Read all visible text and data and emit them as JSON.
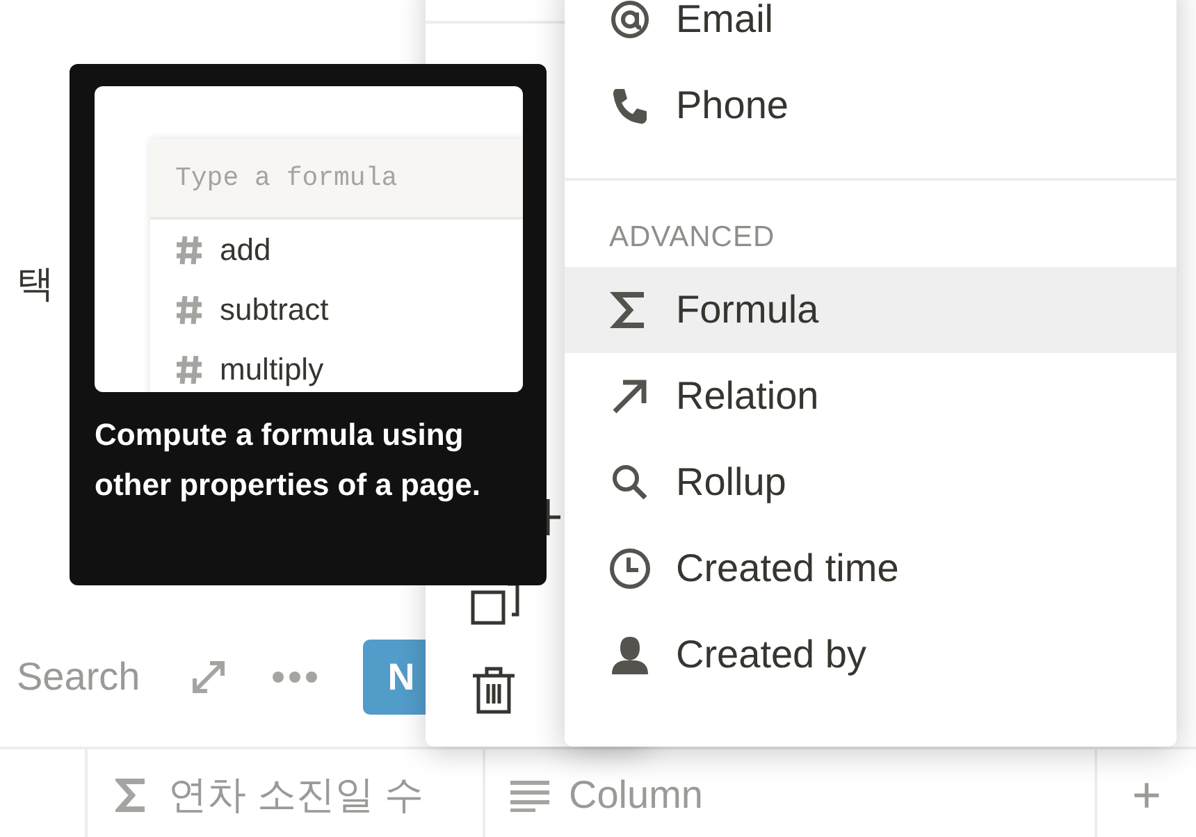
{
  "page": {
    "heading_fragment": "택",
    "toolbar": {
      "search_label": "Search",
      "new_button": "N"
    },
    "table_header": [
      {
        "kind": "formula",
        "label": "연차 소진일 수"
      },
      {
        "kind": "text",
        "label": "Column"
      },
      {
        "kind": "add",
        "label": "+"
      }
    ]
  },
  "back_menu": {
    "items": [
      {
        "kind": "insert"
      },
      {
        "kind": "duplicate"
      },
      {
        "kind": "delete"
      }
    ]
  },
  "type_menu": {
    "sections": [
      {
        "items": [
          {
            "kind": "email",
            "label": "Email",
            "highlighted": false
          },
          {
            "kind": "phone",
            "label": "Phone",
            "highlighted": false
          }
        ]
      },
      {
        "header": "ADVANCED",
        "items": [
          {
            "kind": "formula",
            "label": "Formula",
            "highlighted": true
          },
          {
            "kind": "relation",
            "label": "Relation",
            "highlighted": false
          },
          {
            "kind": "rollup",
            "label": "Rollup",
            "highlighted": false
          },
          {
            "kind": "created_time",
            "label": "Created time",
            "highlighted": false
          },
          {
            "kind": "created_by",
            "label": "Created by",
            "highlighted": false
          }
        ]
      }
    ]
  },
  "tooltip": {
    "preview": {
      "placeholder": "Type a formula",
      "functions": [
        "add",
        "subtract",
        "multiply"
      ]
    },
    "text": "Compute a formula using other properties of a page."
  }
}
